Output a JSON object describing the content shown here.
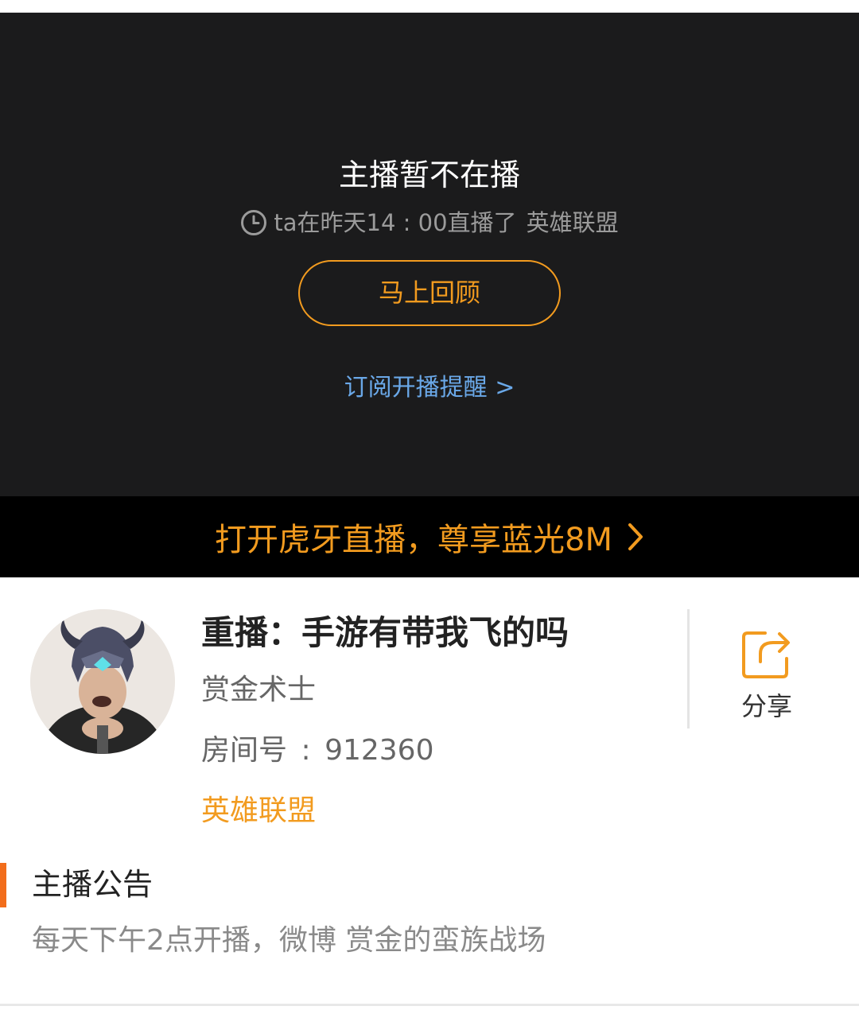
{
  "player": {
    "offline_title": "主播暂不在播",
    "last_live_text": "ta在昨天14 : 00直播了",
    "last_live_game": "英雄联盟",
    "replay_button": "马上回顾",
    "subscribe_link": "订阅开播提醒 >"
  },
  "promo": {
    "text": "打开虎牙直播，尊享蓝光8M"
  },
  "room": {
    "title": "重播：手游有带我飞的吗",
    "streamer_name": "赏金术士",
    "room_number_label": "房间号",
    "room_number_sep": ":",
    "room_number": "912360",
    "game_category": "英雄联盟",
    "share_label": "分享"
  },
  "notice": {
    "heading": "主播公告",
    "body": "每天下午2点开播，微博 赏金的蛮族战场"
  },
  "colors": {
    "accent_orange": "#f29b1f",
    "link_blue": "#6aa8e8",
    "notice_bar": "#f26d1b"
  }
}
